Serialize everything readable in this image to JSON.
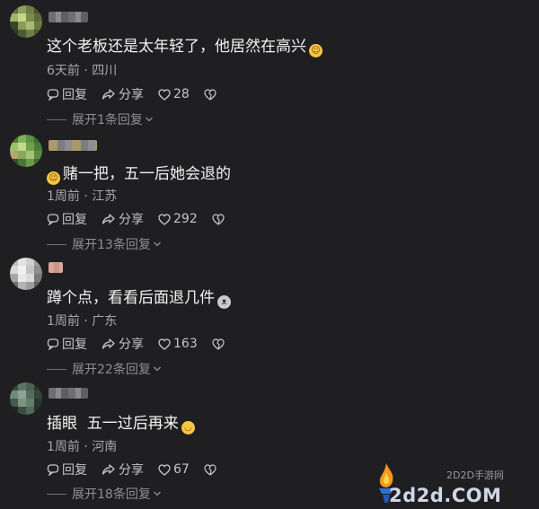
{
  "comments": [
    {
      "text": "这个老板还是太年轻了，他居然在高兴",
      "emoji_icon": "blush-emoji",
      "emoji_position": "end",
      "meta": "6天前 · 四川",
      "reply": "回复",
      "share": "分享",
      "likes": "28",
      "expand": "展开1条回复"
    },
    {
      "text": "赌一把，五一后她会退的",
      "emoji_icon": "wink-emoji",
      "emoji_position": "start",
      "meta": "1周前 · 江苏",
      "reply": "回复",
      "share": "分享",
      "likes": "292",
      "expand": "展开13条回复"
    },
    {
      "text": "蹲个点，看看后面退几件",
      "emoji_icon": "raccoon-emoji",
      "emoji_position": "end",
      "meta": "1周前 · 广东",
      "reply": "回复",
      "share": "分享",
      "likes": "163",
      "expand": "展开22条回复"
    },
    {
      "text": "插眼  五一过后再来",
      "emoji_icon": "grin-emoji",
      "emoji_position": "end",
      "meta": "1周前 · 河南",
      "reply": "回复",
      "share": "分享",
      "likes": "67",
      "expand": "展开18条回复"
    }
  ],
  "watermark": {
    "small": "2D2D手游网",
    "big": "2d2d.COM"
  },
  "colors": {
    "background": "#1f1f21",
    "text": "#f2f2f2",
    "meta": "#a7a7ab",
    "expand": "#8f8f93"
  }
}
